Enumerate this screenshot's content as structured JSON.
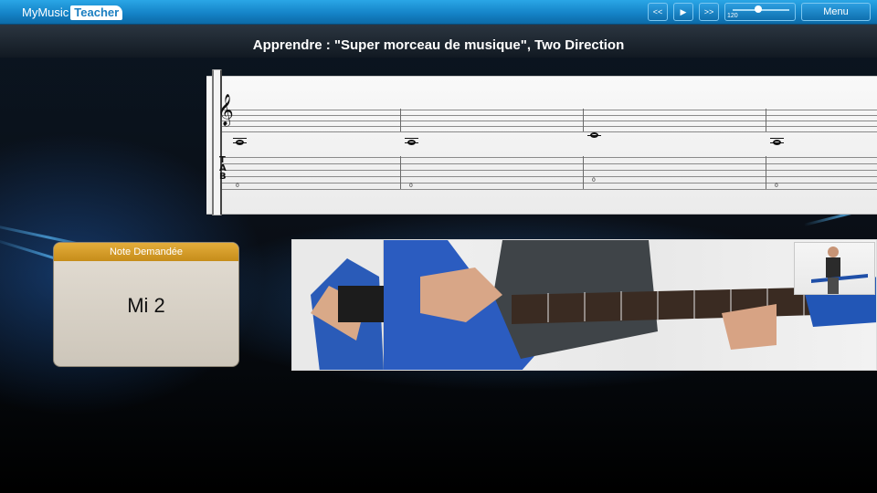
{
  "app": {
    "logo_part1": "MyMusic",
    "logo_part2": "Teacher"
  },
  "toolbar": {
    "rewind_label": "<<",
    "play_label": "▶",
    "forward_label": ">>",
    "tempo_value": "120",
    "tempo_level": 0.45,
    "menu_label": "Menu"
  },
  "header": {
    "title": "Apprendre : \"Super morceau de musique\", Two Direction"
  },
  "score": {
    "measures": [
      {
        "fret": "0"
      },
      {
        "fret": "0"
      },
      {
        "fret": "0"
      },
      {
        "fret": "0"
      }
    ]
  },
  "note_panel": {
    "heading": "Note Demandée",
    "value": "Mi 2"
  },
  "colors": {
    "topbar": "#1584c8",
    "panel_header": "#d69e2a",
    "panel_body": "#d8d1c6"
  }
}
